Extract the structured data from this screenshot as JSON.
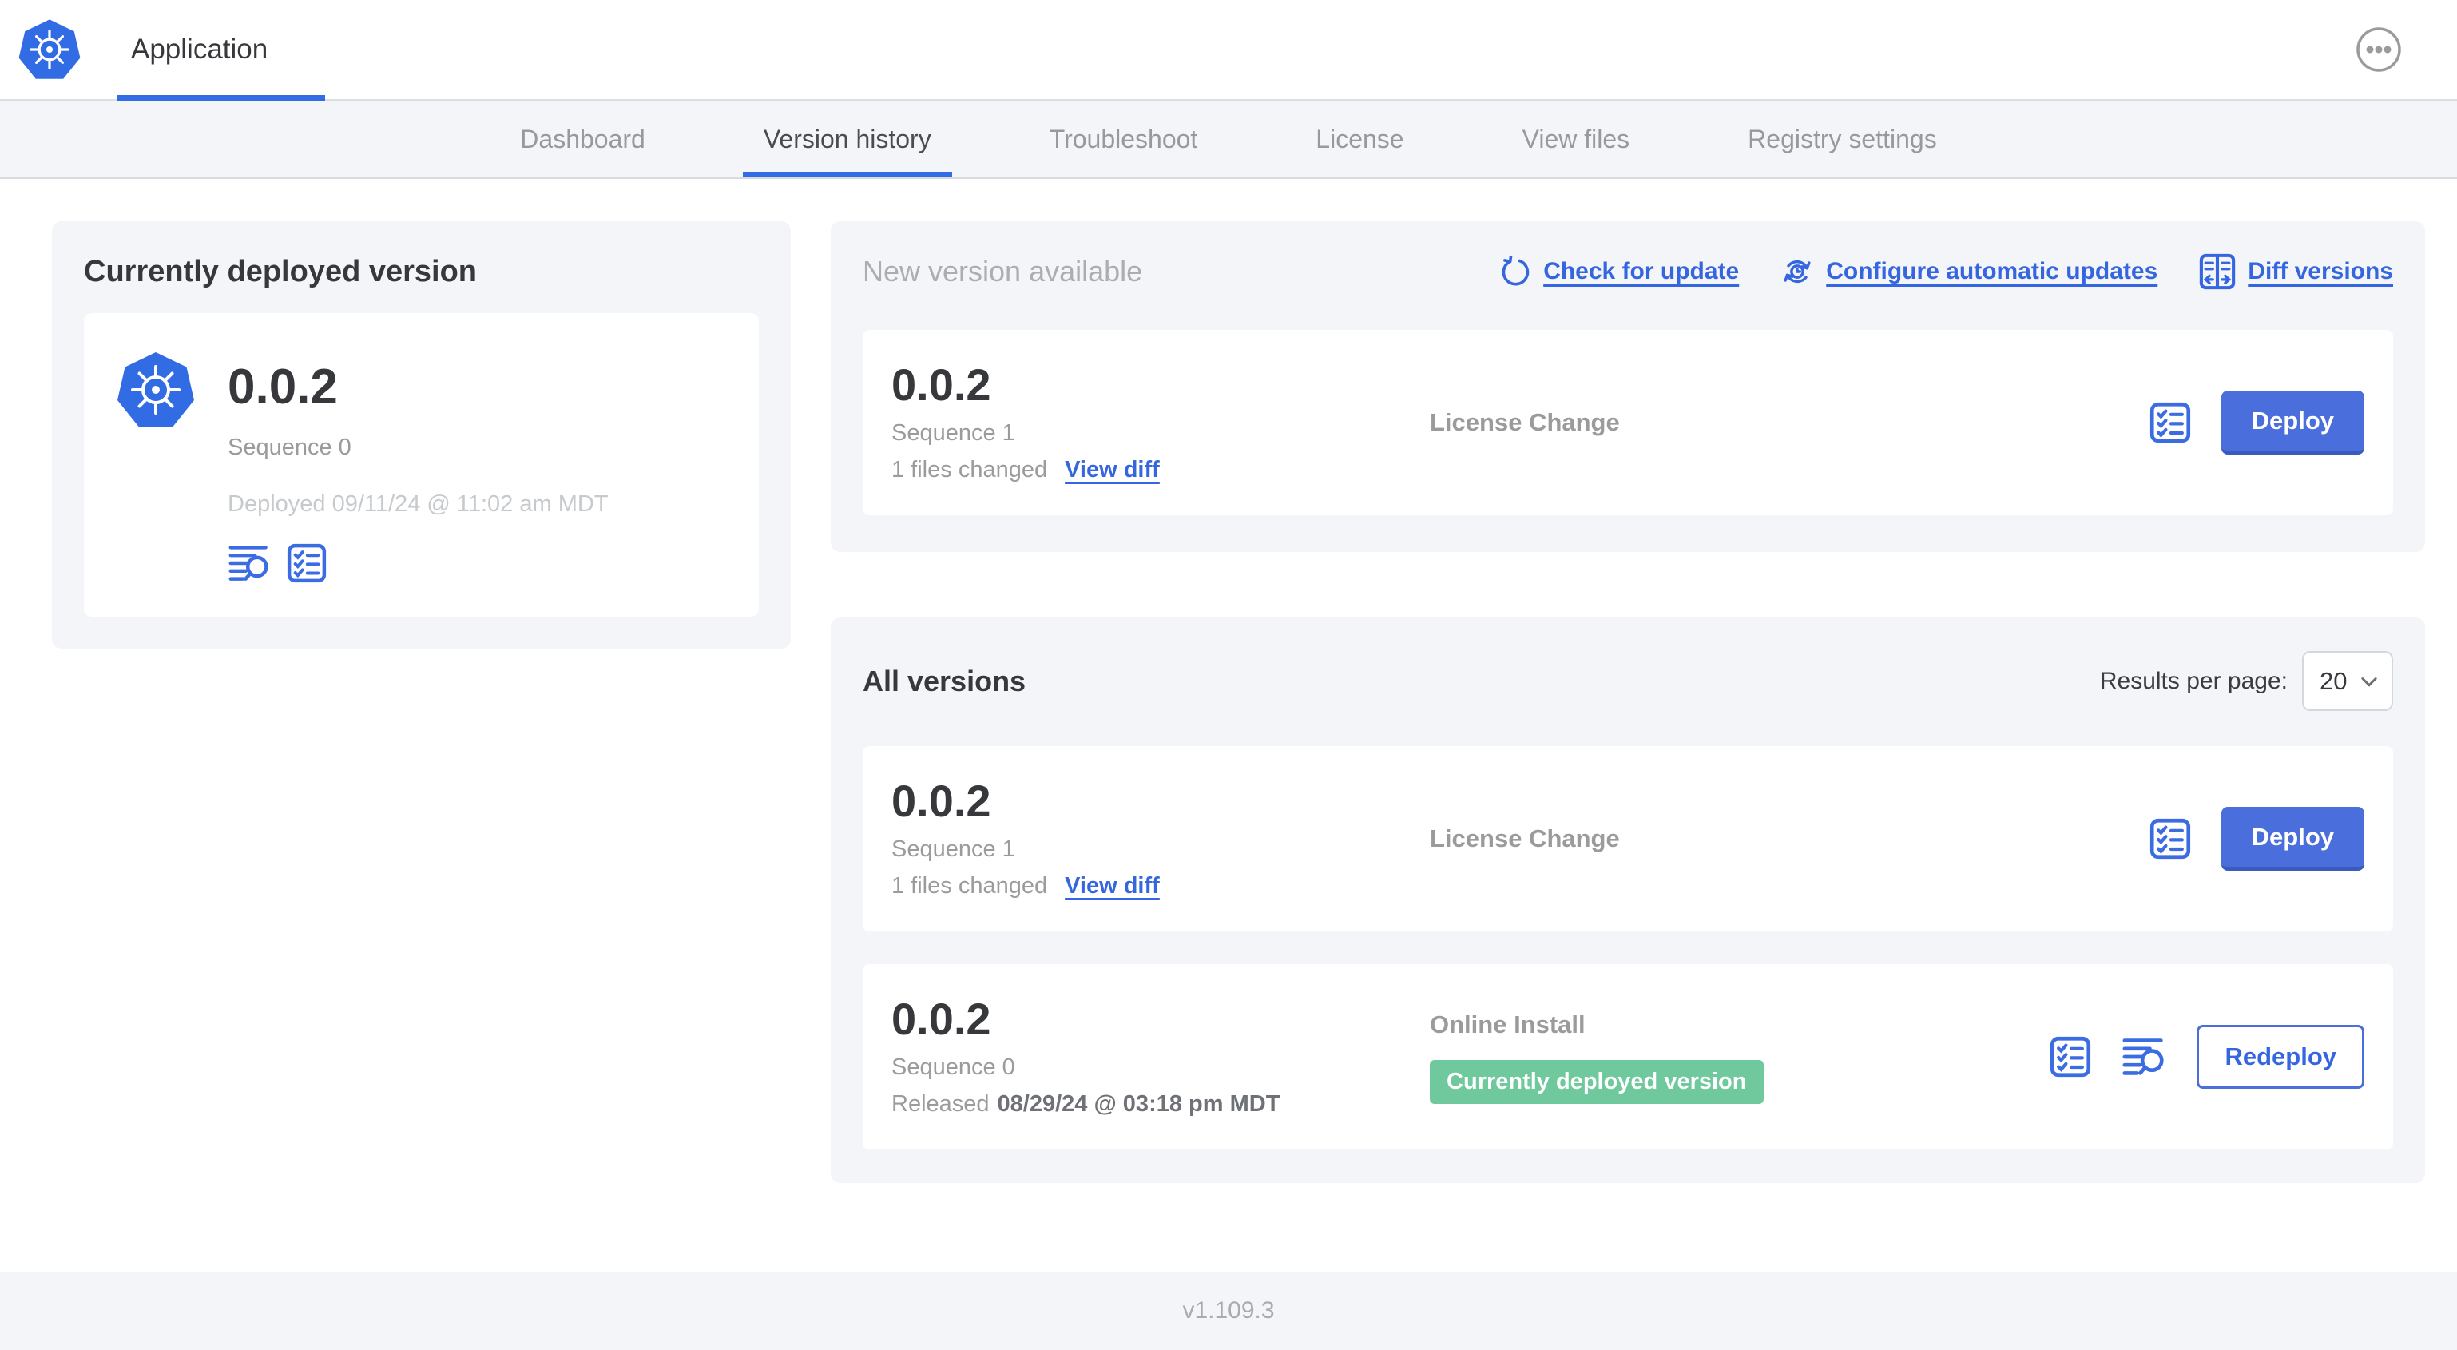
{
  "colors": {
    "brand_blue": "#326CE5",
    "link_blue": "#3566E0",
    "button_blue": "#4A6FDC",
    "badge_green": "#6FC99C",
    "active_tab_underline": "#326DE6"
  },
  "icons": {
    "app_logo": "kubernetes-logo",
    "header_menu": "ellipsis-circle-icon",
    "check_for_update": "refresh-arrow-icon",
    "configure_updates": "auto-update-clock-icon",
    "diff_versions": "diff-columns-icon",
    "release_notes": "checklist-icon",
    "deploy_logs": "logs-search-icon",
    "results_select": "chevron-down-icon"
  },
  "header": {
    "app_title": "Application"
  },
  "nav": {
    "tabs": [
      {
        "label": "Dashboard"
      },
      {
        "label": "Version history"
      },
      {
        "label": "Troubleshoot"
      },
      {
        "label": "License"
      },
      {
        "label": "View files"
      },
      {
        "label": "Registry settings"
      }
    ]
  },
  "current_deployment": {
    "title": "Currently deployed version",
    "version": "0.0.2",
    "sequence": "Sequence 0",
    "deployed_at": "Deployed 09/11/24 @ 11:02 am MDT"
  },
  "new_version": {
    "heading": "New version available",
    "check_for_update": "Check for update",
    "configure_updates": "Configure automatic updates",
    "diff_versions": "Diff versions",
    "card": {
      "version": "0.0.2",
      "sequence": "Sequence 1",
      "files_changed": "1 files changed",
      "view_diff": "View diff",
      "source": "License Change",
      "deploy_label": "Deploy"
    }
  },
  "all_versions": {
    "heading": "All versions",
    "results_per_page_label": "Results per page:",
    "results_per_page_value": "20",
    "rows": [
      {
        "version": "0.0.2",
        "sequence": "Sequence 1",
        "files_changed": "1 files changed",
        "view_diff": "View diff",
        "source": "License Change",
        "action_label": "Deploy"
      },
      {
        "version": "0.0.2",
        "sequence": "Sequence 0",
        "released_prefix": "Released",
        "released_date": "08/29/24 @ 03:18 pm MDT",
        "source": "Online Install",
        "badge": "Currently deployed version",
        "action_label": "Redeploy"
      }
    ]
  },
  "footer": {
    "app_manager_version": "v1.109.3"
  }
}
